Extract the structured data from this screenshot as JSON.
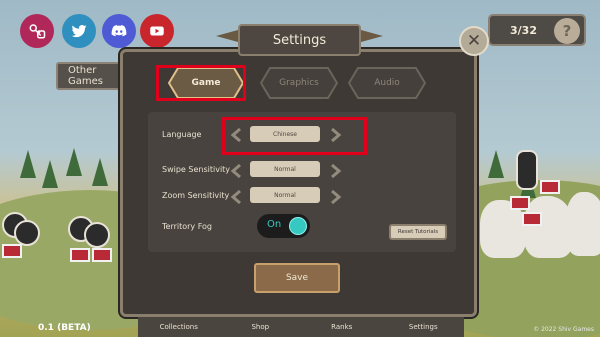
{
  "header": {
    "title": "Settings",
    "close_icon": "close-icon",
    "counter_value": "3/32",
    "counter_badge": "?"
  },
  "social": {
    "items": [
      {
        "icon": "key-instagram-icon",
        "color": "#b02859"
      },
      {
        "icon": "twitter-icon",
        "color": "#2f8fbf"
      },
      {
        "icon": "discord-icon",
        "color": "#4f5bd5"
      },
      {
        "icon": "youtube-icon",
        "color": "#c8262c"
      }
    ]
  },
  "side": {
    "other_games_label": "Other Games"
  },
  "tabs": [
    {
      "label": "Game",
      "active": true
    },
    {
      "label": "Graphics",
      "active": false
    },
    {
      "label": "Audio",
      "active": false
    }
  ],
  "settings": {
    "language": {
      "label": "Language",
      "value": "Chinese"
    },
    "swipe": {
      "label": "Swipe Sensitivity",
      "value": "Normal"
    },
    "zoom": {
      "label": "Zoom Sensitivity",
      "value": "Normal"
    },
    "fog": {
      "label": "Territory Fog",
      "value": "On"
    },
    "reset_label": "Reset Tutorials"
  },
  "actions": {
    "save_label": "Save"
  },
  "footer": {
    "version": "0.1 (BETA)",
    "copyright": "© 2022 Shiv Games",
    "nav": [
      "Collections",
      "Shop",
      "Ranks",
      "Settings"
    ]
  },
  "colors": {
    "accent": "#36c9c2",
    "highlight": "#e0001b",
    "panel": "#3e3935"
  }
}
